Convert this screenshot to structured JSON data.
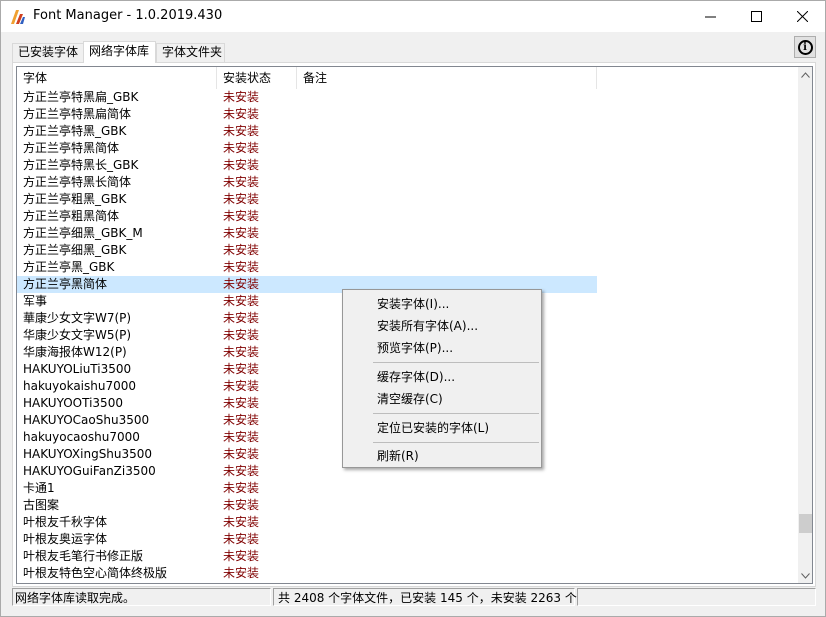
{
  "window": {
    "title": "Font Manager - 1.0.2019.430",
    "controls": {
      "minimize": "—",
      "maximize": "☐",
      "close": "✕"
    }
  },
  "tabs": [
    {
      "label": "已安装字体",
      "active": false
    },
    {
      "label": "网络字体库",
      "active": true
    },
    {
      "label": "字体文件夹",
      "active": false
    }
  ],
  "info_button": {
    "glyph": "i",
    "icon": "info-icon"
  },
  "list": {
    "columns": [
      "字体",
      "安装状态",
      "备注"
    ],
    "rows": [
      {
        "name": "方正兰亭特黑扁_GBK",
        "status": "未安装"
      },
      {
        "name": "方正兰亭特黑扁简体",
        "status": "未安装"
      },
      {
        "name": "方正兰亭特黑_GBK",
        "status": "未安装"
      },
      {
        "name": "方正兰亭特黑简体",
        "status": "未安装"
      },
      {
        "name": "方正兰亭特黑长_GBK",
        "status": "未安装"
      },
      {
        "name": "方正兰亭特黑长简体",
        "status": "未安装"
      },
      {
        "name": "方正兰亭粗黑_GBK",
        "status": "未安装"
      },
      {
        "name": "方正兰亭粗黑简体",
        "status": "未安装"
      },
      {
        "name": "方正兰亭细黑_GBK_M",
        "status": "未安装"
      },
      {
        "name": "方正兰亭细黑_GBK",
        "status": "未安装"
      },
      {
        "name": "方正兰亭黑_GBK",
        "status": "未安装"
      },
      {
        "name": "方正兰亭黑简体",
        "status": "未安装",
        "selected": true
      },
      {
        "name": "军事",
        "status": "未安装"
      },
      {
        "name": "華康少女文字W7(P)",
        "status": "未安装"
      },
      {
        "name": "华康少女文字W5(P)",
        "status": "未安装"
      },
      {
        "name": "华康海报体W12(P)",
        "status": "未安装"
      },
      {
        "name": "HAKUYOLiuTi3500",
        "status": "未安装"
      },
      {
        "name": "hakuyokaishu7000",
        "status": "未安装"
      },
      {
        "name": "HAKUYOOTi3500",
        "status": "未安装"
      },
      {
        "name": "HAKUYOCaoShu3500",
        "status": "未安装"
      },
      {
        "name": "hakuyocaoshu7000",
        "status": "未安装"
      },
      {
        "name": "HAKUYOXingShu3500",
        "status": "未安装"
      },
      {
        "name": "HAKUYOGuiFanZi3500",
        "status": "未安装"
      },
      {
        "name": "卡通1",
        "status": "未安装"
      },
      {
        "name": "古图案",
        "status": "未安装"
      },
      {
        "name": "叶根友千秋字体",
        "status": "未安装"
      },
      {
        "name": "叶根友奥运字体",
        "status": "未安装"
      },
      {
        "name": "叶根友毛笔行书修正版",
        "status": "未安装"
      },
      {
        "name": "叶根友特色空心简体终极版",
        "status": "未安装"
      }
    ]
  },
  "context_menu": {
    "items": [
      "安装字体(I)...",
      "安装所有字体(A)...",
      "预览字体(P)...",
      "缓存字体(D)...",
      "清空缓存(C)",
      "定位已安装的字体(L)",
      "刷新(R)"
    ]
  },
  "status_bar": {
    "left": "网络字体库读取完成。",
    "middle": "共 2408 个字体文件，已安装 145 个，未安装 2263 个",
    "right": ""
  },
  "colors": {
    "status_text": "#800000",
    "selection": "#cce8ff"
  }
}
